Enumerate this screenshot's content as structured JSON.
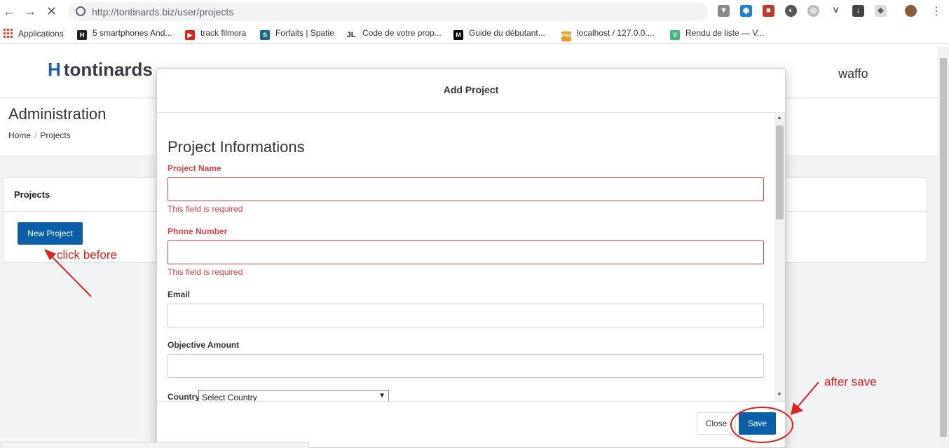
{
  "browser": {
    "url": "http://tontinards.biz/user/projects",
    "bookmarks": [
      {
        "label": "Applications",
        "icon": "apps-grid-icon"
      },
      {
        "label": "5 smartphones And...",
        "icon": "H",
        "color": "#222222"
      },
      {
        "label": "track filmora",
        "icon": "youtube-icon",
        "color": "#e62117"
      },
      {
        "label": "Forfaits | Spatie",
        "icon": "S",
        "color": "#1b6a8c"
      },
      {
        "label": "Code de votre prop...",
        "icon": "JL",
        "color": "#ffffff"
      },
      {
        "label": "Guide du débutant...",
        "icon": "M",
        "color": "#000000"
      },
      {
        "label": "localhost / 127.0.0....",
        "icon": "phpmyadmin-icon",
        "color": "#f29b1f"
      },
      {
        "label": "Rendu de liste — V...",
        "icon": "vue-icon",
        "color": "#41b883"
      }
    ]
  },
  "app": {
    "logo_text": "tontinards",
    "username": "waffo",
    "page_title": "Administration",
    "breadcrumb": [
      "Home",
      "Projects"
    ],
    "card_title": "Projects",
    "new_project_label": "New Project"
  },
  "modal": {
    "title": "Add Project",
    "section_title": "Project Informations",
    "fields": [
      {
        "label": "Project Name",
        "error": "This field is required",
        "value": ""
      },
      {
        "label": "Phone Number",
        "error": "This field is required",
        "value": ""
      },
      {
        "label": "Email",
        "value": ""
      },
      {
        "label": "Objective Amount",
        "value": ""
      }
    ],
    "country_label": "Country",
    "country_selected": "Select Country",
    "close_label": "Close",
    "save_label": "Save"
  },
  "annotations": {
    "before": "click before",
    "after": "after save",
    "color": "#e02020"
  }
}
